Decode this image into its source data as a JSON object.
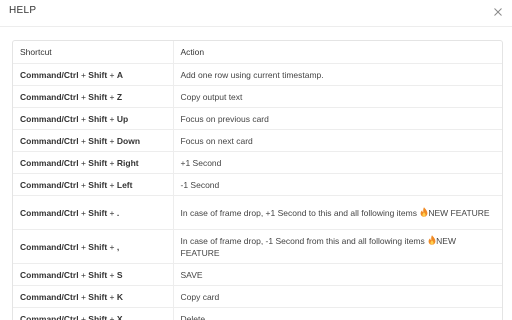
{
  "dialog": {
    "title": "HELP",
    "close_icon": "close-icon"
  },
  "table": {
    "headers": [
      "Shortcut",
      "Action"
    ],
    "plus": "+",
    "rows": [
      {
        "keys": [
          "Command/Ctrl",
          "Shift",
          "A"
        ],
        "action": "Add one row using current timestamp."
      },
      {
        "keys": [
          "Command/Ctrl",
          "Shift",
          "Z"
        ],
        "action": "Copy output text"
      },
      {
        "keys": [
          "Command/Ctrl",
          "Shift",
          "Up"
        ],
        "action": "Focus on previous card"
      },
      {
        "keys": [
          "Command/Ctrl",
          "Shift",
          "Down"
        ],
        "action": "Focus on next card"
      },
      {
        "keys": [
          "Command/Ctrl",
          "Shift",
          "Right"
        ],
        "action": "+1 Second"
      },
      {
        "keys": [
          "Command/Ctrl",
          "Shift",
          "Left"
        ],
        "action": "-1 Second"
      },
      {
        "keys": [
          "Command/Ctrl",
          "Shift",
          "."
        ],
        "action": "In case of frame drop, +1 Second to this and all following items",
        "badge_icon": "fire-icon",
        "badge": "NEW FEATURE"
      },
      {
        "keys": [
          "Command/Ctrl",
          "Shift",
          ","
        ],
        "action": "In case of frame drop, -1 Second from this and all following items",
        "badge_icon": "fire-icon",
        "badge": "NEW FEATURE"
      },
      {
        "keys": [
          "Command/Ctrl",
          "Shift",
          "S"
        ],
        "action": "SAVE"
      },
      {
        "keys": [
          "Command/Ctrl",
          "Shift",
          "K"
        ],
        "action": "Copy card"
      },
      {
        "keys": [
          "Command/Ctrl",
          "Shift",
          "X"
        ],
        "action": "Delete"
      }
    ]
  },
  "colors": {
    "text": "#333333",
    "border": "#ededed",
    "fire": "#f08a24"
  }
}
